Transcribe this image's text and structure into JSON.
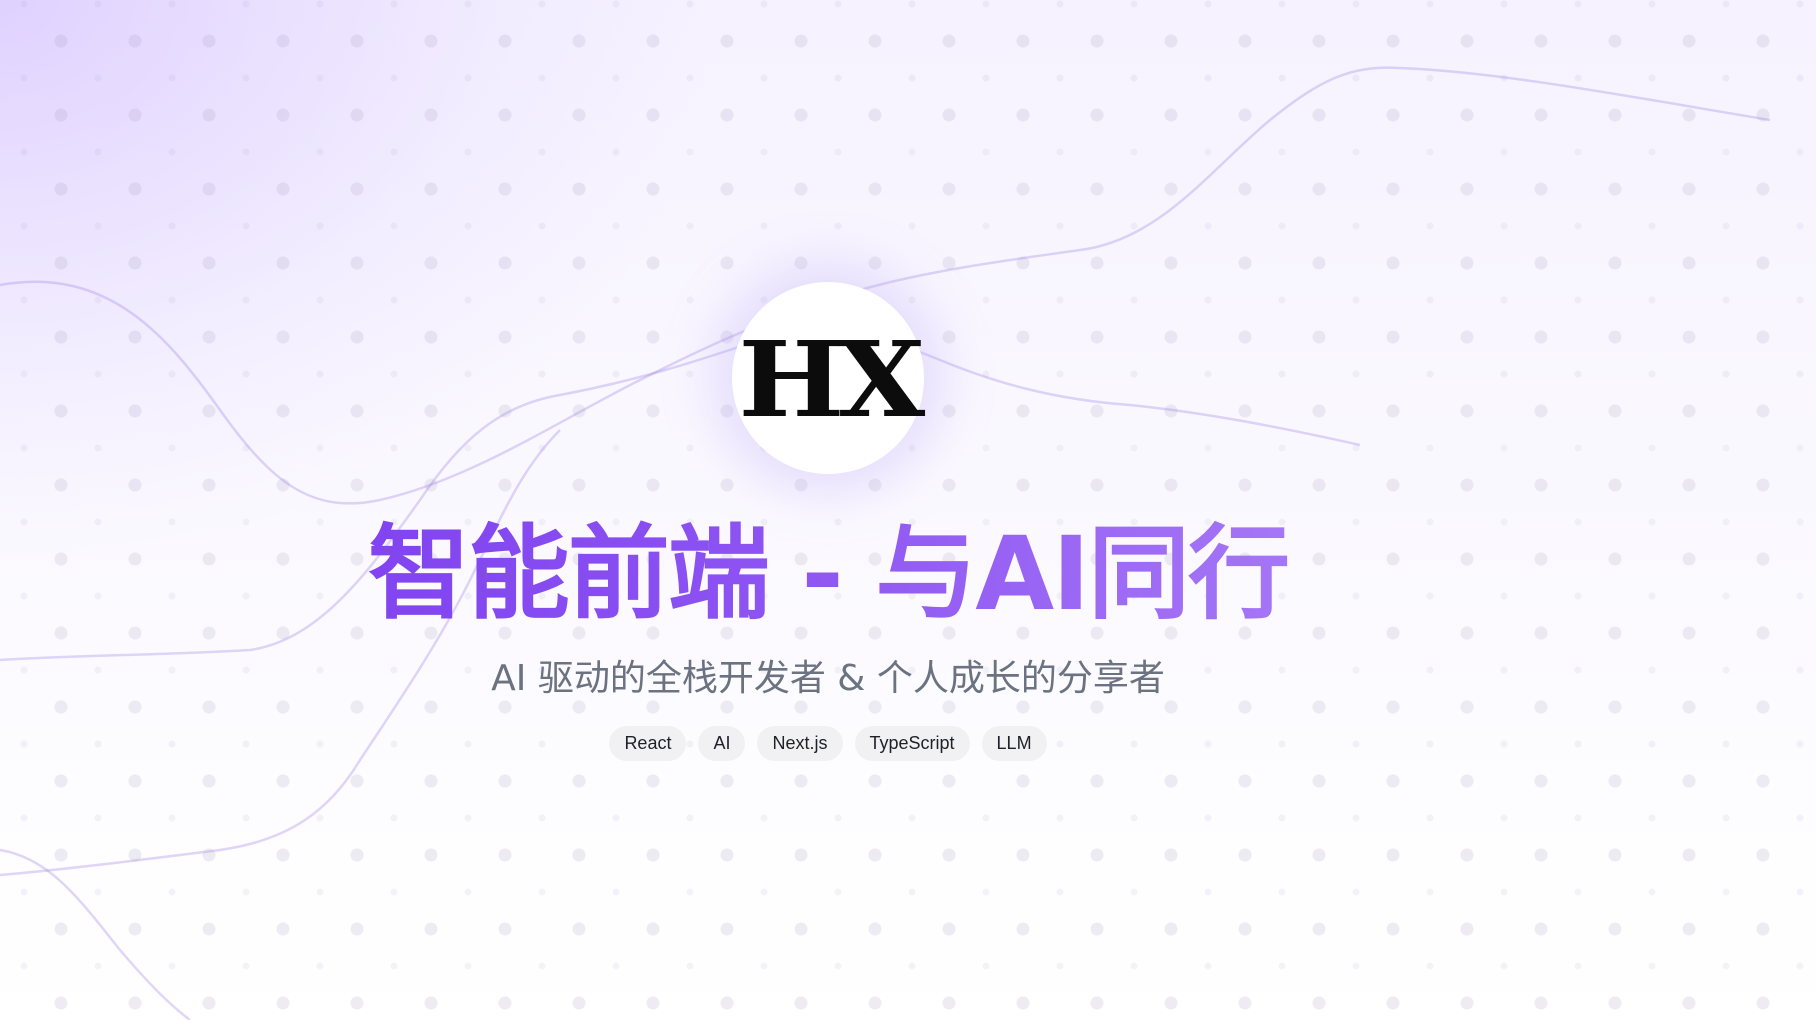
{
  "logo": {
    "text": "HX"
  },
  "hero": {
    "title": "智能前端 - 与AI同行",
    "subtitle": "AI 驱动的全栈开发者 & 个人成长的分享者"
  },
  "tags": [
    {
      "label": "React"
    },
    {
      "label": "AI"
    },
    {
      "label": "Next.js"
    },
    {
      "label": "TypeScript"
    },
    {
      "label": "LLM"
    }
  ],
  "colors": {
    "accent_start": "#7333ee",
    "accent_end": "#b893f9",
    "subtitle": "#6b7280",
    "tag_bg": "#f1f1f3"
  }
}
